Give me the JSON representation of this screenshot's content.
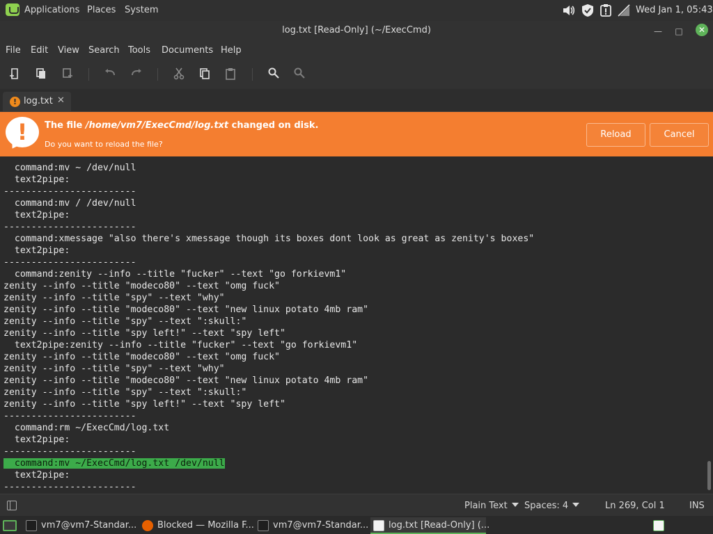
{
  "top_panel": {
    "menus": [
      "Applications",
      "Places",
      "System"
    ],
    "clock": "Wed Jan  1, 05:43",
    "tray_icons": [
      "volume-icon",
      "shield-icon",
      "update-manager-icon",
      "network-disconnected-icon"
    ]
  },
  "window": {
    "title": "log.txt [Read-Only] (~/ExecCmd)"
  },
  "menubar": [
    "File",
    "Edit",
    "View",
    "Search",
    "Tools",
    "Documents",
    "Help"
  ],
  "toolbar": {
    "icons": [
      "new-document-icon",
      "copy-document-icon",
      "open-document-icon",
      "undo-icon",
      "redo-icon",
      "cut-icon",
      "copy-icon",
      "paste-icon",
      "search-icon",
      "search-replace-icon"
    ]
  },
  "tab": {
    "label": "log.txt",
    "close": "✕"
  },
  "infobar": {
    "message_prefix": "The file ",
    "message_path": "/home/vm7/ExecCmd/log.txt",
    "message_suffix": " changed on disk.",
    "question": "Do you want to reload the file?",
    "reload_label": "Reload",
    "cancel_label": "Cancel",
    "color": "#f47e30"
  },
  "editor": {
    "lines": [
      "  command:mv ~ /dev/null",
      "  text2pipe:",
      "------------------------",
      "  command:mv / /dev/null",
      "  text2pipe:",
      "------------------------",
      "  command:xmessage \"also there's xmessage though its boxes dont look as great as zenity's boxes\"",
      "  text2pipe:",
      "------------------------",
      "  command:zenity --info --title \"fucker\" --text \"go forkievm1\"",
      "zenity --info --title \"modeco80\" --text \"omg fuck\"",
      "zenity --info --title \"spy\" --text \"why\"",
      "zenity --info --title \"modeco80\" --text \"new linux potato 4mb ram\"",
      "zenity --info --title \"spy\" --text \":skull:\"",
      "zenity --info --title \"spy left!\" --text \"spy left\"",
      "  text2pipe:zenity --info --title \"fucker\" --text \"go forkievm1\"",
      "zenity --info --title \"modeco80\" --text \"omg fuck\"",
      "zenity --info --title \"spy\" --text \"why\"",
      "zenity --info --title \"modeco80\" --text \"new linux potato 4mb ram\"",
      "zenity --info --title \"spy\" --text \":skull:\"",
      "zenity --info --title \"spy left!\" --text \"spy left\"",
      "------------------------",
      "  command:rm ~/ExecCmd/log.txt",
      "  text2pipe:",
      "------------------------",
      "  command:mv ~/ExecCmd/log.txt /dev/null",
      "  text2pipe:",
      "------------------------"
    ],
    "highlighted_line": "  command:mv ~/ExecCmd/log.txt /dev/null",
    "highlight_color": "#3cab4a"
  },
  "statusbar": {
    "language": "Plain Text",
    "spaces": "Spaces: 4",
    "position": "Ln 269, Col 1",
    "mode": "INS"
  },
  "taskbar": {
    "items": [
      {
        "label": "vm7@vm7-Standar...",
        "icon": "terminal-icon",
        "active": false
      },
      {
        "label": "Blocked — Mozilla F...",
        "icon": "firefox-icon",
        "active": false
      },
      {
        "label": "vm7@vm7-Standar...",
        "icon": "terminal-icon",
        "active": false
      },
      {
        "label": "log.txt [Read-Only] (...",
        "icon": "text-editor-icon",
        "active": true
      }
    ]
  }
}
